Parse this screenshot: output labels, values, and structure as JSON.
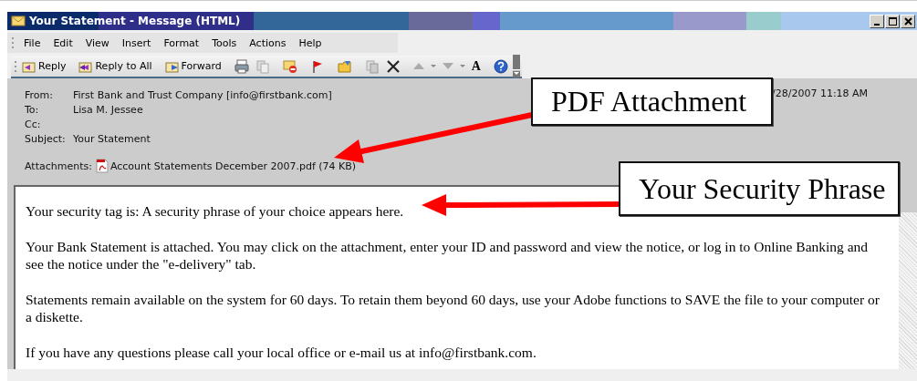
{
  "window": {
    "title": "Your Statement - Message (HTML)"
  },
  "menu": [
    {
      "label": "File"
    },
    {
      "label": "Edit"
    },
    {
      "label": "View"
    },
    {
      "label": "Insert"
    },
    {
      "label": "Format"
    },
    {
      "label": "Tools"
    },
    {
      "label": "Actions"
    },
    {
      "label": "Help"
    }
  ],
  "toolbar": {
    "buttons": [
      {
        "label": "Reply"
      },
      {
        "label": "Reply to All"
      },
      {
        "label": "Forward"
      }
    ],
    "font_glyph": "A"
  },
  "header": {
    "fields": [
      {
        "label": "From:",
        "value": "First Bank and Trust Company [info@firstbank.com]"
      },
      {
        "label": "To:",
        "value": "Lisa M. Jessee"
      },
      {
        "label": "Cc:"
      },
      {
        "label": "Subject:",
        "value": "Your Statement"
      }
    ],
    "sent": "/28/2007 11:18 AM",
    "attachments_label": "Attachments:",
    "attachment": "Account Statements December 2007.pdf (74 KB)"
  },
  "body": {
    "paragraphs": [
      "Your security tag is: A security phrase of your choice appears here.",
      "Your Bank Statement is attached. You may click on the attachment, enter your ID and password and view the notice, or log in to Online Banking and see the notice under the \"e-delivery\" tab.",
      "Statements remain available on the system for 60 days. To retain them beyond 60 days, use your Adobe functions to SAVE the file to your computer or a diskette.",
      "If you have any questions please call your local office or e-mail us at info@firstbank.com."
    ]
  },
  "callouts": [
    {
      "text": "PDF Attachment"
    },
    {
      "text": "Your Security Phrase"
    }
  ]
}
